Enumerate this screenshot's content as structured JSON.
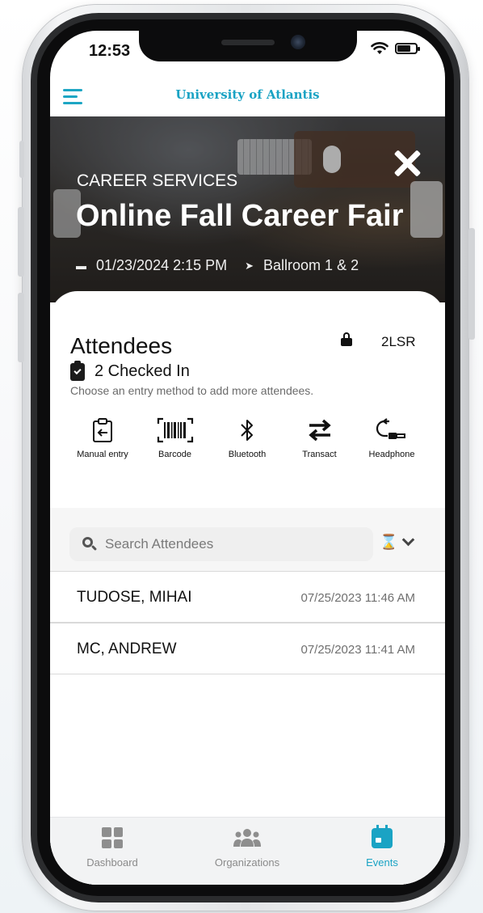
{
  "status_bar": {
    "time": "12:53"
  },
  "header": {
    "logo_text": "University of Atlantis"
  },
  "hero": {
    "category": "CAREER SERVICES",
    "title": "Online Fall Career Fair",
    "datetime": "01/23/2024 2:15 PM",
    "location": "Ballroom 1 & 2"
  },
  "attendees": {
    "title": "Attendees",
    "code": "2LSR",
    "checked_in": "2 Checked In",
    "hint": "Choose an entry method to add more attendees."
  },
  "entry_methods": [
    {
      "label": "Manual entry",
      "icon": "clipboard-arrow-icon"
    },
    {
      "label": "Barcode",
      "icon": "barcode-icon"
    },
    {
      "label": "Bluetooth",
      "icon": "bluetooth-icon"
    },
    {
      "label": "Transact",
      "icon": "transfer-arrows-icon"
    },
    {
      "label": "Headphone",
      "icon": "headphone-jack-icon"
    }
  ],
  "search": {
    "placeholder": "Search Attendees"
  },
  "list": [
    {
      "name": "TUDOSE, MIHAI",
      "time": "07/25/2023 11:46 AM"
    },
    {
      "name": "MC, ANDREW",
      "time": "07/25/2023 11:41 AM"
    }
  ],
  "tabs": [
    {
      "label": "Dashboard",
      "active": false
    },
    {
      "label": "Organizations",
      "active": false
    },
    {
      "label": "Events",
      "active": true
    }
  ],
  "colors": {
    "accent": "#1aa3c4",
    "text": "#111111",
    "muted": "#6f6f6f"
  }
}
